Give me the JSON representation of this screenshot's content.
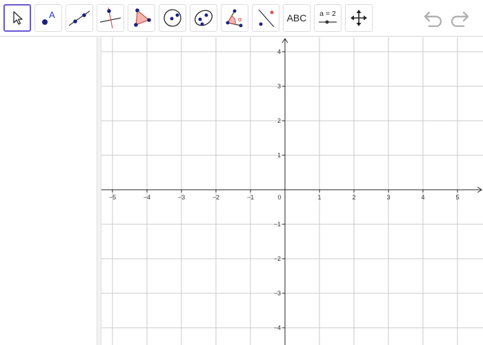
{
  "toolbar": {
    "tools": [
      {
        "id": "move",
        "icon": "move-arrow-icon",
        "selected": true
      },
      {
        "id": "point",
        "icon": "point-icon",
        "label": "A"
      },
      {
        "id": "line",
        "icon": "line-through-points-icon"
      },
      {
        "id": "perpendicular",
        "icon": "perpendicular-line-icon"
      },
      {
        "id": "polygon",
        "icon": "polygon-icon"
      },
      {
        "id": "circle",
        "icon": "circle-center-point-icon"
      },
      {
        "id": "ellipse",
        "icon": "ellipse-icon"
      },
      {
        "id": "angle",
        "icon": "angle-icon",
        "label": "α"
      },
      {
        "id": "reflect",
        "icon": "reflect-about-line-icon"
      },
      {
        "id": "text",
        "icon": "text-icon",
        "label": "ABC"
      },
      {
        "id": "slider",
        "icon": "slider-icon",
        "label": "a = 2"
      },
      {
        "id": "move-graphics",
        "icon": "move-graphics-view-icon"
      }
    ],
    "undo_icon": "undo-icon",
    "redo_icon": "redo-icon"
  },
  "graphics": {
    "x_ticks": [
      "−5",
      "−4",
      "−3",
      "−2",
      "−1",
      "1",
      "2",
      "3",
      "4",
      "5"
    ],
    "y_ticks_pos": [
      "1",
      "2",
      "3",
      "4"
    ],
    "y_ticks_neg": [
      "−1",
      "−2",
      "−3",
      "−4"
    ],
    "origin_label": "0",
    "x_range": [
      -5.3,
      5.7
    ],
    "y_range": [
      -4.4,
      4.4
    ]
  },
  "colors": {
    "selected_border": "#6557d2",
    "point_blue": "#1a237e",
    "polygon_fill": "#f4b5b0",
    "angle_red": "#c0392b",
    "point_red": "#e05252",
    "text_blue": "#1c3ec9",
    "grid": "#c8c8c8",
    "axis": "#222222",
    "history_grey": "#b0b0b0"
  }
}
